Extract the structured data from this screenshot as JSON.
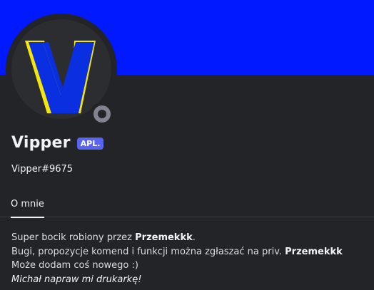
{
  "colors": {
    "banner": "#0019ff",
    "background": "#232428",
    "bot_tag": "#5865f2",
    "avatar_blue": "#0a2fe0",
    "avatar_yellow": "#f5e60a",
    "status_offline": "#80848e"
  },
  "profile": {
    "display_name": "Vipper",
    "bot_tag": "APL.",
    "username": "Vipper#9675",
    "avatar_icon": "v-logo-icon",
    "status_icon": "offline-status-icon"
  },
  "tabs": [
    {
      "label": "O mnie",
      "active": true
    }
  ],
  "about": {
    "line1_pre": "Super bocik robiony przez ",
    "line1_bold": "Przemekkk",
    "line1_post": ".",
    "line2_pre": "Bugi, propozycje komend i funkcji można zgłaszać na priv. ",
    "line2_bold": "Przemekkk",
    "line3": "Może dodam coś nowego :)",
    "line4_italic": "Michał napraw mi drukarkę!"
  }
}
